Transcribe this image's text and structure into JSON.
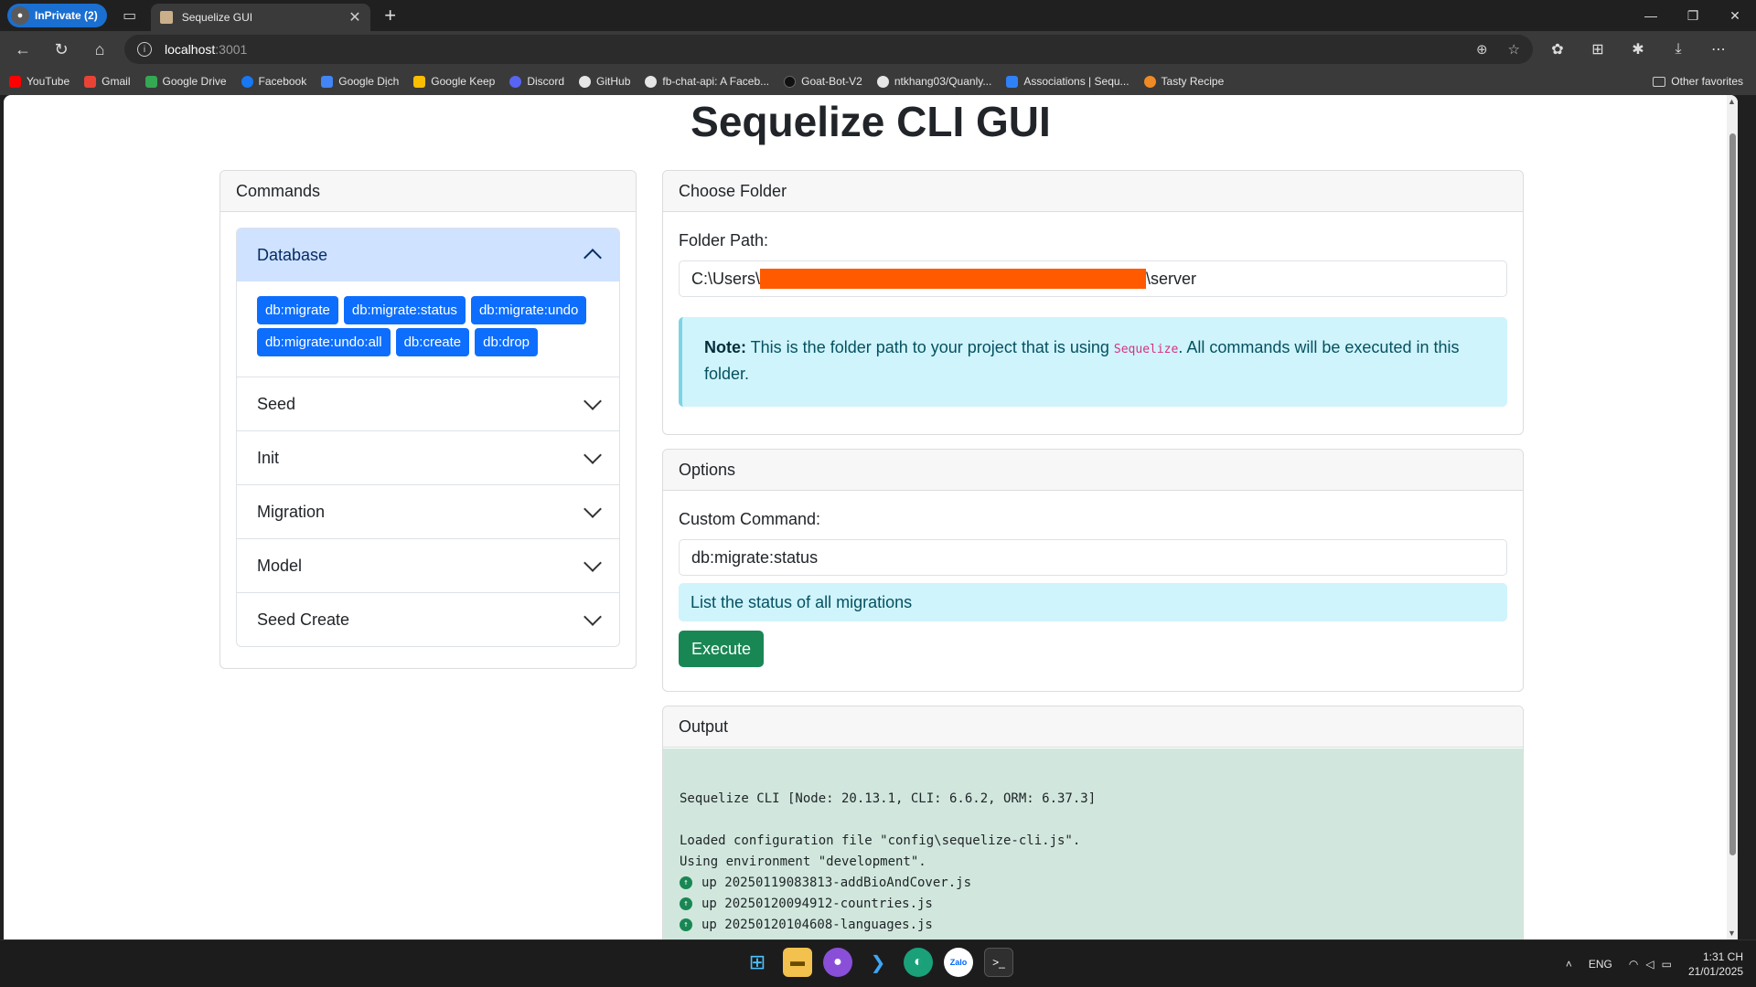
{
  "browser": {
    "profile_label": "InPrivate (2)",
    "tab_title": "Sequelize GUI",
    "address_host": "localhost",
    "address_port": ":3001",
    "bookmarks": [
      "YouTube",
      "Gmail",
      "Google Drive",
      "Facebook",
      "Google Dịch",
      "Google Keep",
      "Discord",
      "GitHub",
      "fb-chat-api: A Faceb...",
      "Goat-Bot-V2",
      "ntkhang03/Quanly...",
      "Associations | Sequ...",
      "Tasty Recipe"
    ],
    "other_favorites": "Other favorites"
  },
  "page": {
    "title": "Sequelize CLI GUI"
  },
  "commands": {
    "header": "Commands",
    "groups": [
      "Database",
      "Seed",
      "Init",
      "Migration",
      "Model",
      "Seed Create"
    ],
    "database_buttons": [
      "db:migrate",
      "db:migrate:status",
      "db:migrate:undo",
      "db:migrate:undo:all",
      "db:create",
      "db:drop"
    ]
  },
  "folder": {
    "header": "Choose Folder",
    "label": "Folder Path:",
    "path_prefix": "C:\\Users\\",
    "path_suffix": "\\server",
    "note_bold": "Note:",
    "note_text_1": " This is the folder path to your project that is using ",
    "note_code": "Sequelize",
    "note_text_2": ". All commands will be executed in this folder."
  },
  "options": {
    "header": "Options",
    "label": "Custom Command:",
    "value": "db:migrate:status",
    "description": "List the status of all migrations",
    "execute_label": "Execute"
  },
  "output": {
    "header": "Output",
    "line1": "Sequelize CLI [Node: 20.13.1, CLI: 6.6.2, ORM: 6.37.3]",
    "line2": "Loaded configuration file \"config\\sequelize-cli.js\".",
    "line3": "Using environment \"development\".",
    "migrations": [
      "up 20250119083813-addBioAndCover.js",
      "up 20250120094912-countries.js",
      "up 20250120104608-languages.js"
    ]
  },
  "taskbar": {
    "lang": "ENG",
    "time": "1:31 CH",
    "date": "21/01/2025"
  },
  "colors": {
    "primary": "#0d6efd",
    "success": "#198754",
    "info_bg": "#cff4fc",
    "output_bg": "#d1e7dd",
    "accordion_open": "#cfe2ff"
  }
}
